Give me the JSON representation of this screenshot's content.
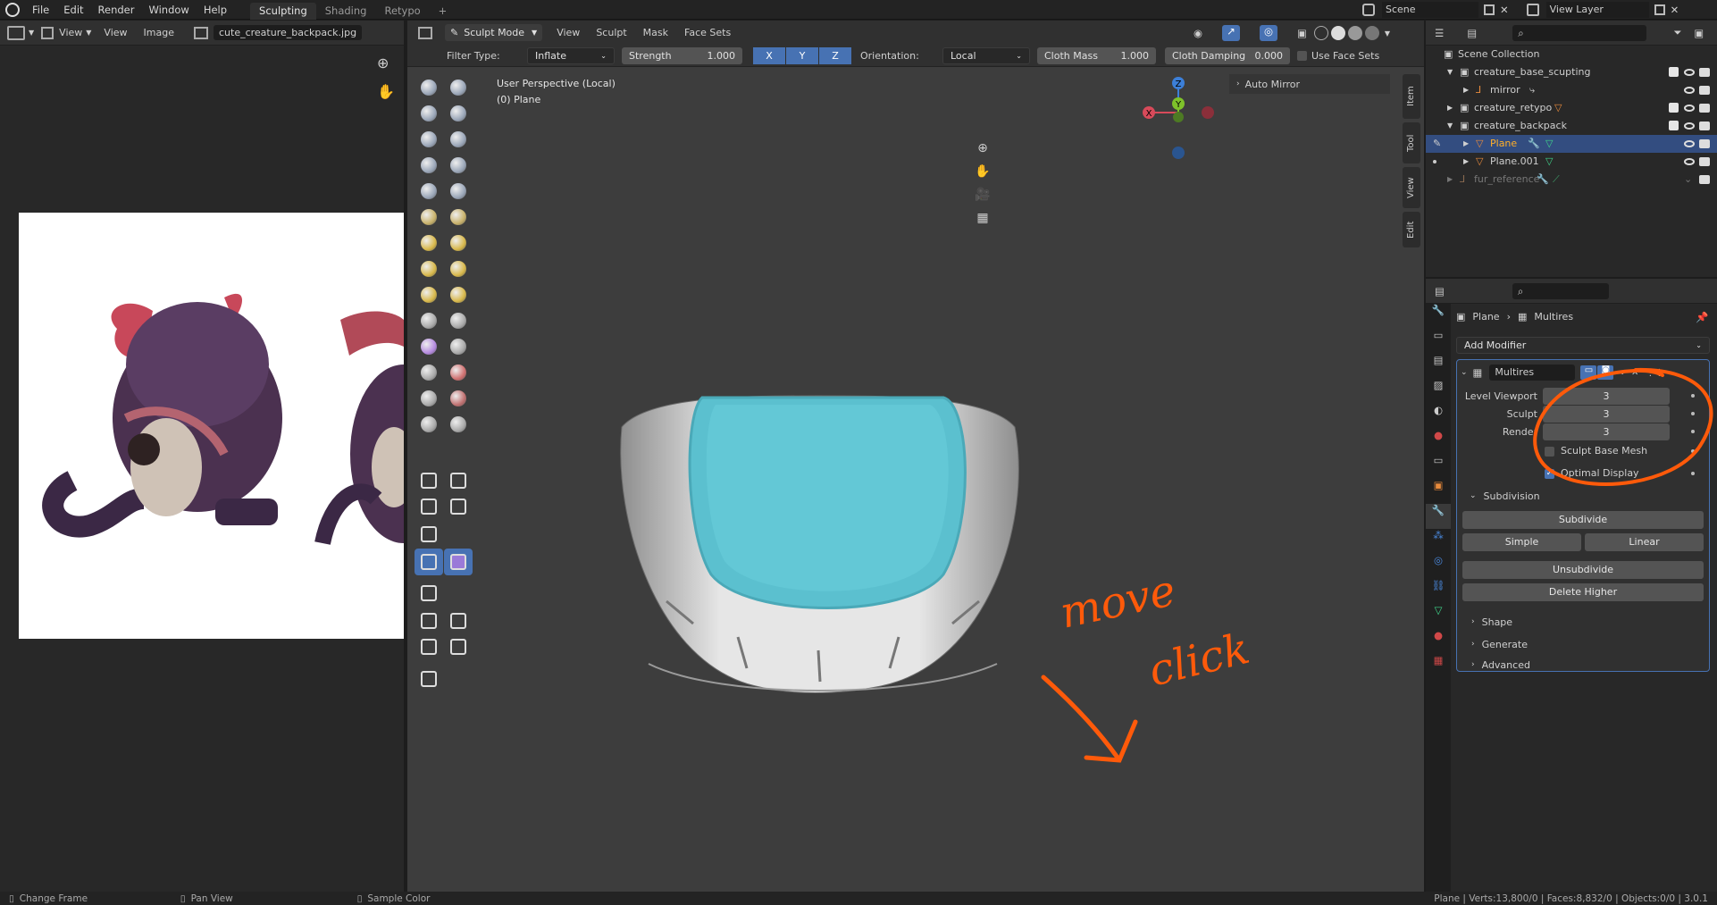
{
  "topbar": {
    "menus": [
      "File",
      "Edit",
      "Render",
      "Window",
      "Help"
    ],
    "workspaces": [
      "Sculpting",
      "Shading",
      "Retypo"
    ],
    "active_workspace": "Sculpting",
    "add_tab": "+",
    "scene": "Scene",
    "view_layer": "View Layer"
  },
  "image_editor": {
    "menus": [
      "View",
      "View",
      "Image"
    ],
    "image_name": "cute_creature_backpack.jpg"
  },
  "viewport": {
    "mode": "Sculpt Mode",
    "menus": [
      "View",
      "Sculpt",
      "Mask",
      "Face Sets"
    ],
    "filter_type_label": "Filter Type:",
    "filter_type": "Inflate",
    "strength_label": "Strength",
    "strength": "1.000",
    "axes": [
      "X",
      "Y",
      "Z"
    ],
    "orientation_label": "Orientation:",
    "orientation": "Local",
    "cloth_mass_label": "Cloth Mass",
    "cloth_mass": "1.000",
    "cloth_damping_label": "Cloth Damping",
    "cloth_damping": "0.000",
    "use_face_sets": "Use Face Sets",
    "perspective": "User Perspective (Local)",
    "object": "(0) Plane",
    "auto_mirror": "Auto Mirror",
    "side_tabs": [
      "Item",
      "Tool",
      "View",
      "Edit"
    ],
    "gizmo": {
      "x": "X",
      "y": "Y",
      "z": "Z"
    },
    "annotation": [
      "move",
      "click"
    ]
  },
  "outliner": {
    "rows": [
      {
        "label": "Scene Collection"
      },
      {
        "label": "creature_base_scupting"
      },
      {
        "label": "mirror"
      },
      {
        "label": "creature_retypo"
      },
      {
        "label": "creature_backpack"
      },
      {
        "label": "Plane"
      },
      {
        "label": "Plane.001"
      },
      {
        "label": "fur_reference"
      }
    ]
  },
  "properties": {
    "breadcrumb_object": "Plane",
    "breadcrumb_modifier": "Multires",
    "add_modifier": "Add Modifier",
    "modifier_name": "Multires",
    "level_viewport_label": "Level Viewport",
    "level_viewport": "3",
    "sculpt_label": "Sculpt",
    "sculpt": "3",
    "render_label": "Render",
    "render": "3",
    "sculpt_base_mesh": "Sculpt Base Mesh",
    "optimal_display": "Optimal Display",
    "subdivision_label": "Subdivision",
    "subdivide": "Subdivide",
    "simple": "Simple",
    "linear": "Linear",
    "unsubdivide": "Unsubdivide",
    "delete_higher": "Delete Higher",
    "shape": "Shape",
    "generate": "Generate",
    "advanced": "Advanced"
  },
  "statusbar": {
    "change_frame": "Change Frame",
    "pan_view": "Pan View",
    "sample_color": "Sample Color",
    "stats": "Plane | Verts:13,800/0 | Faces:8,832/0 | Objects:0/0 | 3.0.1"
  },
  "colors": {
    "accent": "#4772b3",
    "annotation": "#ff5a0a",
    "mesh_cyan": "#5bc0cf",
    "selected_row": "#334d80"
  }
}
